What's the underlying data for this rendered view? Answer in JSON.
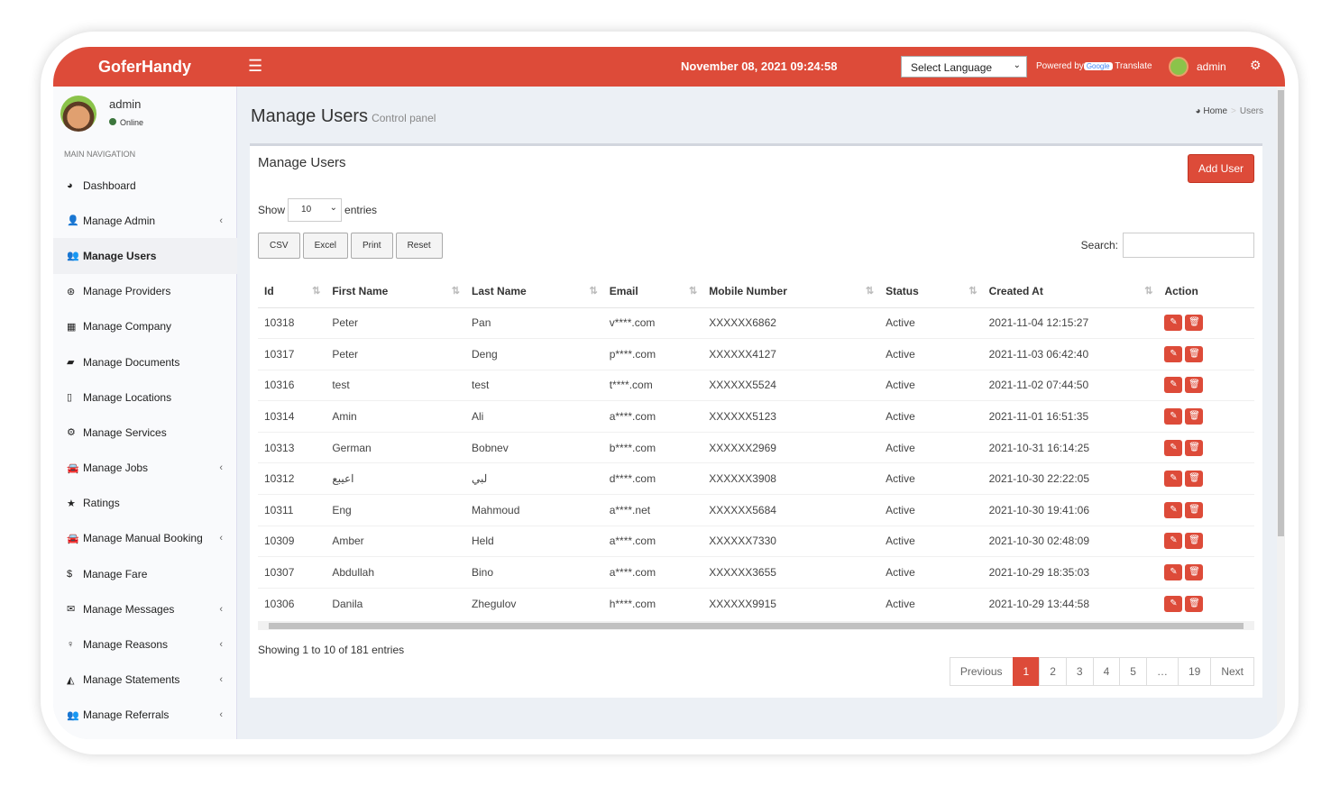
{
  "brand": "GoferHandy",
  "datetime": "November 08, 2021 09:24:58",
  "language_select": "Select Language",
  "powered_by": "Powered by",
  "google": "Google",
  "translate": "Translate",
  "top_user": "admin",
  "accent": "#dd4b39",
  "sidebar": {
    "user": "admin",
    "status": "Online",
    "heading": "MAIN NAVIGATION",
    "items": [
      {
        "label": "Dashboard",
        "icon": "dashboard-icon",
        "glyph": "◕",
        "chev": false
      },
      {
        "label": "Manage Admin",
        "icon": "user-plus-icon",
        "glyph": "👤",
        "chev": true
      },
      {
        "label": "Manage Users",
        "icon": "users-icon",
        "glyph": "👥",
        "chev": false
      },
      {
        "label": "Manage Providers",
        "icon": "providers-icon",
        "glyph": "⊛",
        "chev": false
      },
      {
        "label": "Manage Company",
        "icon": "building-icon",
        "glyph": "▦",
        "chev": false
      },
      {
        "label": "Manage Documents",
        "icon": "book-icon",
        "glyph": "▰",
        "chev": false
      },
      {
        "label": "Manage Locations",
        "icon": "map-icon",
        "glyph": "▯",
        "chev": false
      },
      {
        "label": "Manage Services",
        "icon": "cogs-icon",
        "glyph": "⚙",
        "chev": false
      },
      {
        "label": "Manage Jobs",
        "icon": "car-icon",
        "glyph": "🚘",
        "chev": true
      },
      {
        "label": "Ratings",
        "icon": "star-icon",
        "glyph": "★",
        "chev": false
      },
      {
        "label": "Manage Manual Booking",
        "icon": "car-icon",
        "glyph": "🚘",
        "chev": true
      },
      {
        "label": "Manage Fare",
        "icon": "dollar-icon",
        "glyph": "$",
        "chev": false
      },
      {
        "label": "Manage Messages",
        "icon": "envelope-icon",
        "glyph": "✉",
        "chev": true
      },
      {
        "label": "Manage Reasons",
        "icon": "lightbulb-icon",
        "glyph": "♀",
        "chev": true
      },
      {
        "label": "Manage Statements",
        "icon": "area-chart-icon",
        "glyph": "◭",
        "chev": true
      },
      {
        "label": "Manage Referrals",
        "icon": "users-icon",
        "glyph": "👥",
        "chev": true
      }
    ]
  },
  "page": {
    "title": "Manage Users",
    "subtitle": "Control panel",
    "breadcrumb_home": "Home",
    "breadcrumb_sep": ">",
    "breadcrumb_current": "Users"
  },
  "box": {
    "title": "Manage Users",
    "add_user": "Add User",
    "show": "Show",
    "entries_value": "10",
    "entries": "entries",
    "buttons": [
      "CSV",
      "Excel",
      "Print",
      "Reset"
    ],
    "search_label": "Search:",
    "columns": [
      "Id",
      "First Name",
      "Last Name",
      "Email",
      "Mobile Number",
      "Status",
      "Created At",
      "Action"
    ],
    "rows": [
      [
        "10318",
        "Peter",
        "Pan",
        "v****.com",
        "XXXXXX6862",
        "Active",
        "2021-11-04 12:15:27"
      ],
      [
        "10317",
        "Peter",
        "Deng",
        "p****.com",
        "XXXXXX4127",
        "Active",
        "2021-11-03 06:42:40"
      ],
      [
        "10316",
        "test",
        "test",
        "t****.com",
        "XXXXXX5524",
        "Active",
        "2021-11-02 07:44:50"
      ],
      [
        "10314",
        "Amin",
        "Ali",
        "a****.com",
        "XXXXXX5123",
        "Active",
        "2021-11-01 16:51:35"
      ],
      [
        "10313",
        "German",
        "Bobnev",
        "b****.com",
        "XXXXXX2969",
        "Active",
        "2021-10-31 16:14:25"
      ],
      [
        "10312",
        "اعيبع",
        "لبي",
        "d****.com",
        "XXXXXX3908",
        "Active",
        "2021-10-30 22:22:05"
      ],
      [
        "10311",
        "Eng",
        "Mahmoud",
        "a****.net",
        "XXXXXX5684",
        "Active",
        "2021-10-30 19:41:06"
      ],
      [
        "10309",
        "Amber",
        "Held",
        "a****.com",
        "XXXXXX7330",
        "Active",
        "2021-10-30 02:48:09"
      ],
      [
        "10307",
        "Abdullah",
        "Bino",
        "a****.com",
        "XXXXXX3655",
        "Active",
        "2021-10-29 18:35:03"
      ],
      [
        "10306",
        "Danila",
        "Zhegulov",
        "h****.com",
        "XXXXXX9915",
        "Active",
        "2021-10-29 13:44:58"
      ]
    ],
    "info": "Showing 1 to 10 of 181 entries",
    "pagination": [
      "Previous",
      "1",
      "2",
      "3",
      "4",
      "5",
      "…",
      "19",
      "Next"
    ],
    "current_page": "1"
  }
}
